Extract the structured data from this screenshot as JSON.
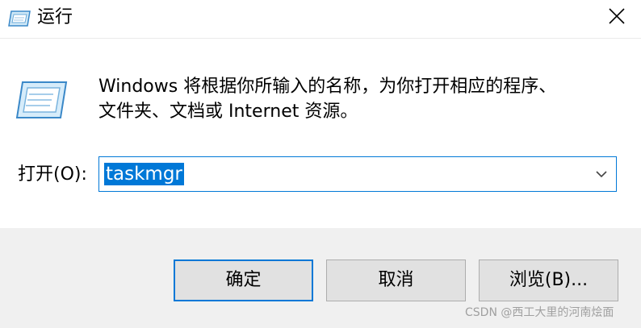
{
  "window": {
    "title": "运行",
    "title_icon": "run-icon",
    "close_icon": "close-icon"
  },
  "content": {
    "icon": "run-dialog-icon",
    "description_line1": "Windows 将根据你所输入的名称，为你打开相应的程序、",
    "description_line2": "文件夹、文档或 Internet 资源。",
    "open_label": "打开(O):",
    "open_value": "taskmgr",
    "dropdown_icon": "chevron-down-icon"
  },
  "buttons": {
    "ok": "确定",
    "cancel": "取消",
    "browse": "浏览(B)..."
  },
  "watermark": "CSDN @西工大里的河南烩面",
  "colors": {
    "accent": "#0078d7",
    "button_face": "#e1e1e1",
    "footer_bg": "#f0f0f0"
  }
}
